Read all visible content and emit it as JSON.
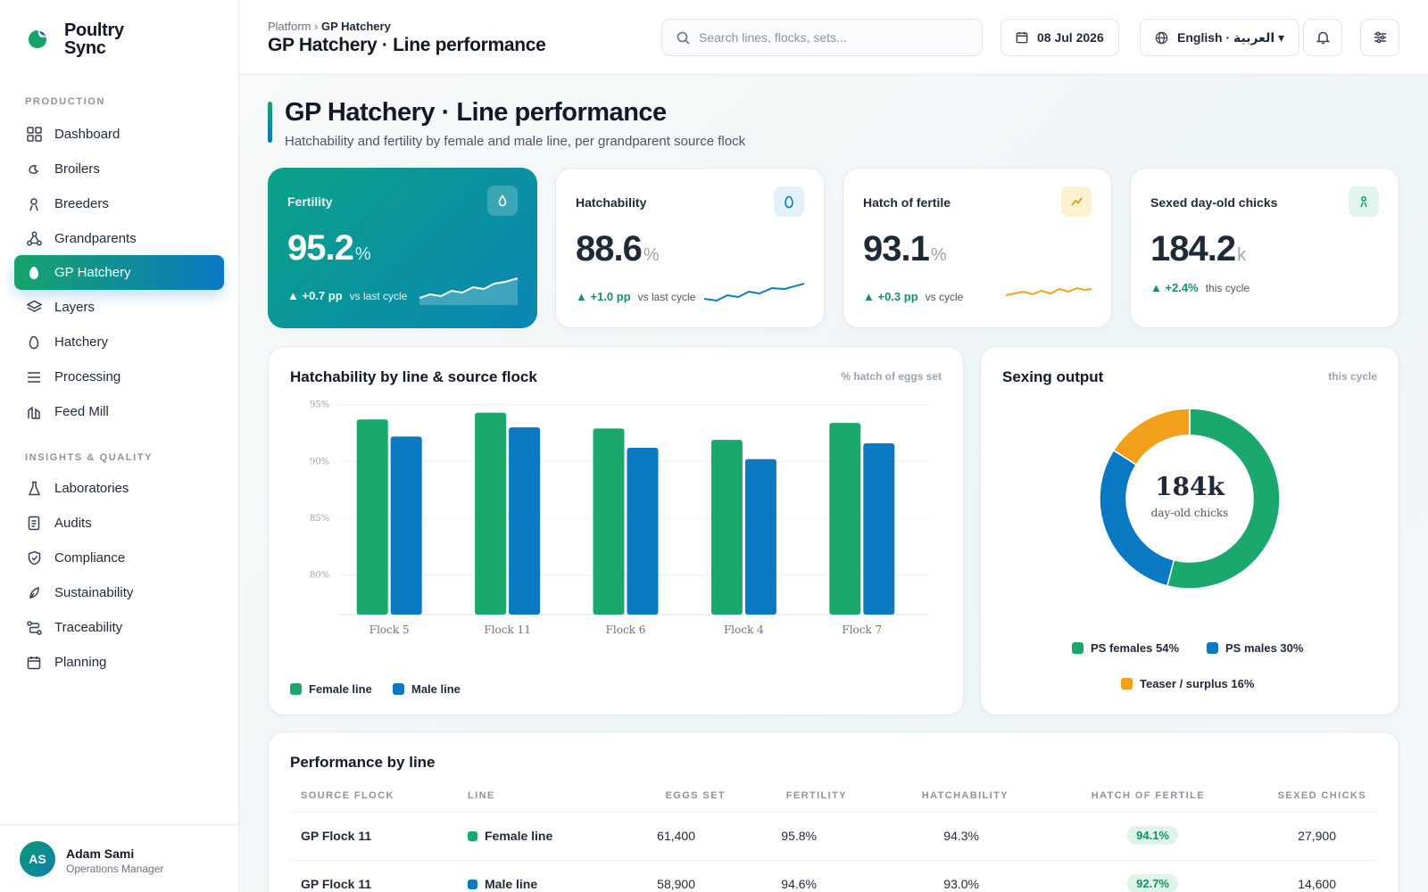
{
  "brand": {
    "name": "Poultry Sync"
  },
  "sidebar": {
    "section_production": "PRODUCTION",
    "section_insights": "INSIGHTS & QUALITY",
    "items": [
      {
        "label": "Dashboard",
        "icon": "grid-icon"
      },
      {
        "label": "Broilers",
        "icon": "chick-icon"
      },
      {
        "label": "Breeders",
        "icon": "person-icon"
      },
      {
        "label": "Grandparents",
        "icon": "tree-icon"
      },
      {
        "label": "GP Hatchery",
        "icon": "egg-icon",
        "active": true
      },
      {
        "label": "Layers",
        "icon": "layers-icon"
      },
      {
        "label": "Hatchery",
        "icon": "egg-outline-icon"
      },
      {
        "label": "Processing",
        "icon": "lines-icon"
      },
      {
        "label": "Feed Mill",
        "icon": "mill-icon"
      }
    ],
    "insights": [
      {
        "label": "Laboratories",
        "icon": "flask-icon"
      },
      {
        "label": "Audits",
        "icon": "clipboard-icon"
      },
      {
        "label": "Compliance",
        "icon": "shield-icon"
      },
      {
        "label": "Sustainability",
        "icon": "leaf-icon"
      },
      {
        "label": "Traceability",
        "icon": "route-icon"
      },
      {
        "label": "Planning",
        "icon": "calendar-icon"
      }
    ]
  },
  "user": {
    "initials": "AS",
    "name": "Adam Sami",
    "role": "Operations Manager"
  },
  "header": {
    "breadcrumb_root": "Platform",
    "breadcrumb_sep": "›",
    "breadcrumb_current": "GP Hatchery",
    "title": "GP Hatchery · Line performance",
    "search_placeholder": "Search lines, flocks, sets...",
    "date": "08 Jul 2026",
    "language": "English · العربية ▾"
  },
  "page": {
    "title": "GP Hatchery · Line performance",
    "subtitle": "Hatchability and fertility by female and male line, per grandparent source flock"
  },
  "kpis": [
    {
      "label": "Fertility",
      "value": "95.2",
      "unit": "%",
      "delta": "▲ +0.7 pp",
      "context": "vs last cycle",
      "icon": "drop-icon"
    },
    {
      "label": "Hatchability",
      "value": "88.6",
      "unit": "%",
      "delta": "▲ +1.0 pp",
      "context": "vs last cycle",
      "icon": "egg-icon"
    },
    {
      "label": "Hatch of fertile",
      "value": "93.1",
      "unit": "%",
      "delta": "▲ +0.3 pp",
      "context": "vs cycle",
      "icon": "trend-icon"
    },
    {
      "label": "Sexed day-old chicks",
      "value": "184.2",
      "unit": "k",
      "delta": "▲ +2.4%",
      "context": "this cycle",
      "icon": "person-icon"
    }
  ],
  "colors": {
    "female": "#1aa86c",
    "male": "#0b78c2",
    "teaser": "#f2a01c",
    "accent": "#0a8fa8"
  },
  "bar_card": {
    "title": "Hatchability by line & source flock",
    "meta": "% hatch of eggs set"
  },
  "donut_card": {
    "title": "Sexing output",
    "meta": "this cycle",
    "center_value": "184k",
    "center_label": "day-old chicks"
  },
  "chart_data": [
    {
      "type": "bar",
      "categories": [
        "Flock 5",
        "Flock 11",
        "Flock 6",
        "Flock 4",
        "Flock 7"
      ],
      "series": [
        {
          "name": "Female line",
          "values": [
            93.7,
            94.3,
            92.9,
            91.9,
            93.4
          ]
        },
        {
          "name": "Male line",
          "values": [
            92.2,
            93.0,
            91.2,
            90.2,
            91.6
          ]
        }
      ],
      "yticks": [
        "95%",
        "90%",
        "85%",
        "80%"
      ],
      "ylim": [
        76.5,
        96
      ],
      "grid": true
    },
    {
      "type": "pie",
      "labels": [
        "PS females 54%",
        "PS males 30%",
        "Teaser / surplus 16%"
      ],
      "values": [
        54,
        30,
        16
      ]
    }
  ],
  "table": {
    "title": "Performance by line",
    "columns": [
      "SOURCE FLOCK",
      "LINE",
      "EGGS SET",
      "FERTILITY",
      "HATCHABILITY",
      "HATCH OF FERTILE",
      "SEXED CHICKS"
    ],
    "rows": [
      {
        "flock": "GP Flock 11",
        "line": "Female line",
        "eggs": "61,400",
        "fertility": "95.8%",
        "hatchability": "94.3%",
        "hof": "94.1%",
        "chicks": "27,900"
      },
      {
        "flock": "GP Flock 11",
        "line": "Male line",
        "eggs": "58,900",
        "fertility": "94.6%",
        "hatchability": "93.0%",
        "hof": "92.7%",
        "chicks": "14,600"
      }
    ]
  }
}
